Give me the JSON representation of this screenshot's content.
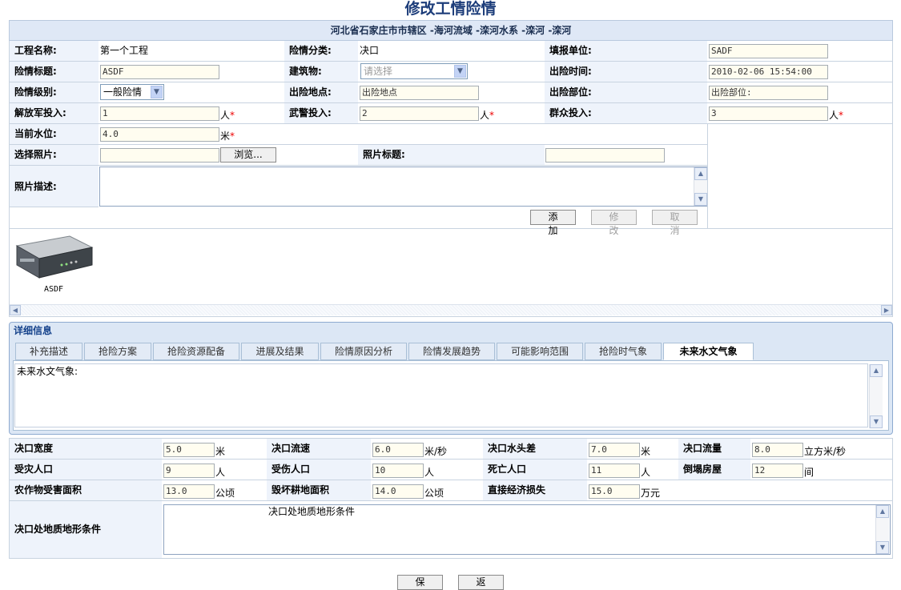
{
  "title": "修改工情险情",
  "location": "河北省石家庄市市辖区 -海河流域 -滦河水系 -滦河 -滦河",
  "form": {
    "project_name_label": "工程名称:",
    "project_name": "第一个工程",
    "danger_class_label": "险情分类:",
    "danger_class": "决口",
    "report_unit_label": "填报单位:",
    "report_unit": "SADF",
    "danger_title_label": "险情标题:",
    "danger_title": "ASDF",
    "building_label": "建筑物:",
    "building_placeholder": "请选择",
    "danger_time_label": "出险时间:",
    "danger_time": "2010-02-06 15:54:00",
    "danger_level_label": "险情级别:",
    "danger_level": "一般险情",
    "danger_place_label": "出险地点:",
    "danger_place": "出险地点",
    "danger_part_label": "出险部位:",
    "danger_part": "出险部位:",
    "army_label": "解放军投入:",
    "army": "1",
    "police_label": "武警投入:",
    "police": "2",
    "public_label": "群众投入:",
    "public": "3",
    "person_unit": "人",
    "water_level_label": "当前水位:",
    "water_level": "4.0",
    "meter_unit": "米",
    "required_mark": "*",
    "photo_label": "选择照片:",
    "browse_label": "浏览...",
    "photo_title_label": "照片标题:",
    "photo_desc_label": "照片描述:",
    "add_label": "添 加",
    "modify_label": "修 改",
    "cancel_label": "取 消"
  },
  "gallery": {
    "items": [
      {
        "caption": "ASDF"
      }
    ]
  },
  "detail": {
    "heading": "详细信息",
    "tabs": [
      "补充描述",
      "抢险方案",
      "抢险资源配备",
      "进展及结果",
      "险情原因分析",
      "险情发展趋势",
      "可能影响范围",
      "抢险时气象",
      "未来水文气象"
    ],
    "active_tab": 8,
    "content": "未来水文气象:"
  },
  "breach": {
    "width_label": "决口宽度",
    "width": "5.0",
    "width_unit": "米",
    "velocity_label": "决口流速",
    "velocity": "6.0",
    "velocity_unit": "米/秒",
    "head_label": "决口水头差",
    "head": "7.0",
    "head_unit": "米",
    "flow_label": "决口流量",
    "flow": "8.0",
    "flow_unit": "立方米/秒",
    "affected_label": "受灾人口",
    "affected": "9",
    "affected_unit": "人",
    "injured_label": "受伤人口",
    "injured": "10",
    "injured_unit": "人",
    "dead_label": "死亡人口",
    "dead": "11",
    "dead_unit": "人",
    "houses_label": "倒塌房屋",
    "houses": "12",
    "houses_unit": "间",
    "crop_label": "农作物受害面积",
    "crop": "13.0",
    "crop_unit": "公顷",
    "farmland_label": "毁坏耕地面积",
    "farmland": "14.0",
    "farmland_unit": "公顷",
    "loss_label": "直接经济损失",
    "loss": "15.0",
    "loss_unit": "万元",
    "geology_label": "决口处地质地形条件",
    "geology": "决口处地质地形条件"
  },
  "footer": {
    "save_label": "保 存",
    "back_label": "返 回"
  }
}
